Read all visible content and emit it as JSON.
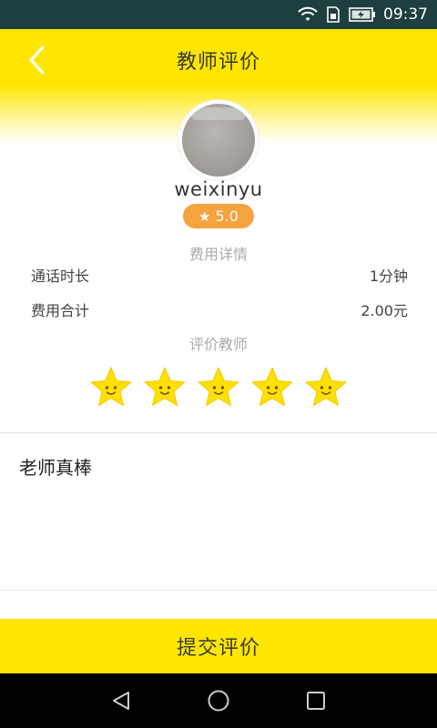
{
  "status_bar": {
    "time": "09:37",
    "icons": [
      "wifi-icon",
      "sim-icon",
      "battery-icon"
    ]
  },
  "header": {
    "title": "教师评价",
    "back_icon": "chevron-left-icon"
  },
  "teacher": {
    "name": "weixinyu",
    "rating": "5.0",
    "rating_icon": "★"
  },
  "fees": {
    "section_label": "费用详情",
    "rows": [
      {
        "label": "通话时长",
        "value": "1分钟"
      },
      {
        "label": "费用合计",
        "value": "2.00元"
      }
    ]
  },
  "evaluation": {
    "section_label": "评价教师",
    "stars_selected": 5,
    "stars_total": 5,
    "comment": "老师真棒"
  },
  "submit": {
    "label": "提交评价"
  },
  "colors": {
    "accent": "#ffe600",
    "badge": "#f5a23f",
    "status_bar": "#1d3f3f",
    "star": "#ffe000"
  },
  "nav": {
    "icons": [
      "back-triangle-icon",
      "home-circle-icon",
      "recents-square-icon"
    ]
  }
}
